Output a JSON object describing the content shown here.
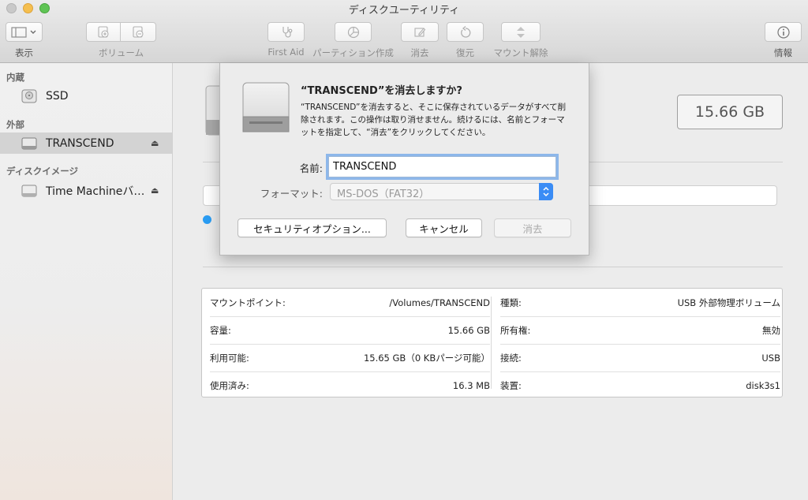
{
  "window": {
    "title": "ディスクユーティリティ"
  },
  "toolbar": {
    "view_label": "表示",
    "volume_label": "ボリューム",
    "firstaid_label": "First Aid",
    "partition_label": "パーティション作成",
    "erase_label": "消去",
    "restore_label": "復元",
    "unmount_label": "マウント解除",
    "info_label": "情報"
  },
  "sidebar": {
    "internal_header": "内蔵",
    "internal_items": [
      {
        "label": "SSD"
      }
    ],
    "external_header": "外部",
    "external_items": [
      {
        "label": "TRANSCEND",
        "selected": true
      }
    ],
    "image_header": "ディスクイメージ",
    "image_items": [
      {
        "label": "Time Machineバ…"
      }
    ]
  },
  "main": {
    "capacity_badge": "15.66 GB",
    "info_left": [
      {
        "key": "マウントポイント:",
        "value": "/Volumes/TRANSCEND"
      },
      {
        "key": "容量:",
        "value": "15.66 GB"
      },
      {
        "key": "利用可能:",
        "value": "15.65 GB（0 KBパージ可能）"
      },
      {
        "key": "使用済み:",
        "value": "16.3 MB"
      }
    ],
    "info_right": [
      {
        "key": "種類:",
        "value": "USB 外部物理ボリューム"
      },
      {
        "key": "所有権:",
        "value": "無効"
      },
      {
        "key": "接続:",
        "value": "USB"
      },
      {
        "key": "装置:",
        "value": "disk3s1"
      }
    ]
  },
  "dialog": {
    "title": "“TRANSCEND”を消去しますか?",
    "message": "“TRANSCEND”を消去すると、そこに保存されているデータがすべて削除されます。この操作は取り消せません。続けるには、名前とフォーマットを指定して、“消去”をクリックしてください。",
    "name_label": "名前:",
    "name_value": "TRANSCEND",
    "format_label": "フォーマット:",
    "format_value": "MS-DOS（FAT32）",
    "security_button": "セキュリティオプション...",
    "cancel_button": "キャンセル",
    "erase_button": "消去"
  },
  "colors": {
    "accent": "#3a8cf5",
    "focus_ring": "#8db7ea",
    "selection": "#d3d3d3"
  }
}
